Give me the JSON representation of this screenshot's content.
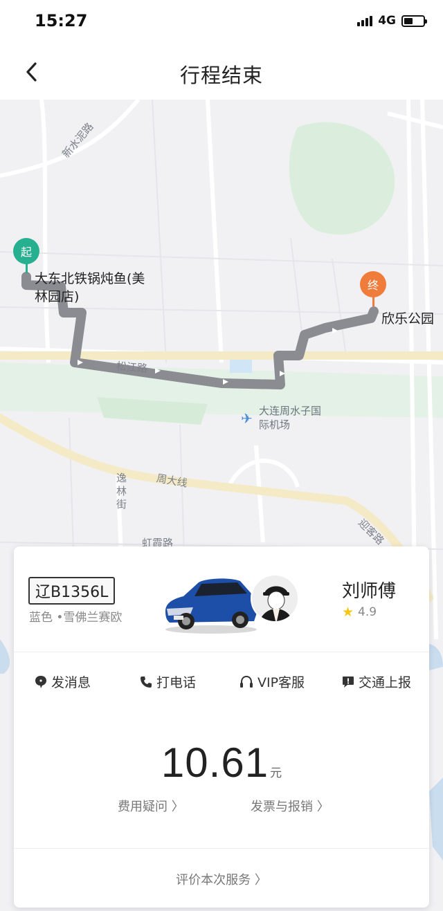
{
  "status_bar": {
    "time": "15:27",
    "network": "4G",
    "battery_level": 0.45
  },
  "nav": {
    "back_icon": "chevron-left-icon",
    "title": "行程结束"
  },
  "map": {
    "road_labels": [
      "新水泥路",
      "松江路",
      "周大线",
      "逸林街",
      "虹霞路",
      "迎客路"
    ],
    "airport_label": "大连周水子国际机场",
    "start": {
      "pin_text": "起",
      "place": "大东北铁锅炖鱼(美林园店)",
      "color": "#26b08f"
    },
    "end": {
      "pin_text": "终",
      "place": "欣乐公园",
      "color": "#f07c3c"
    }
  },
  "trip_card": {
    "plate": "辽B1356L",
    "car_desc": "蓝色 •雪佛兰赛欧",
    "driver_name": "刘师傅",
    "rating": "4.9",
    "actions": [
      {
        "icon": "message-icon",
        "label": "发消息"
      },
      {
        "icon": "phone-icon",
        "label": "打电话"
      },
      {
        "icon": "headset-icon",
        "label": "VIP客服"
      },
      {
        "icon": "report-icon",
        "label": "交通上报"
      }
    ],
    "fare": {
      "amount": "10.61",
      "unit": "元"
    },
    "fee_question": "费用疑问 〉",
    "invoice": "发票与报销 〉",
    "rate_service": "评价本次服务 〉"
  },
  "colors": {
    "route": "#8a8c92",
    "start_pin": "#26b08f",
    "end_pin": "#f07c3c",
    "star": "#f5c518",
    "map_bg": "#f1f1f4",
    "green_area": "#dbeedd"
  }
}
